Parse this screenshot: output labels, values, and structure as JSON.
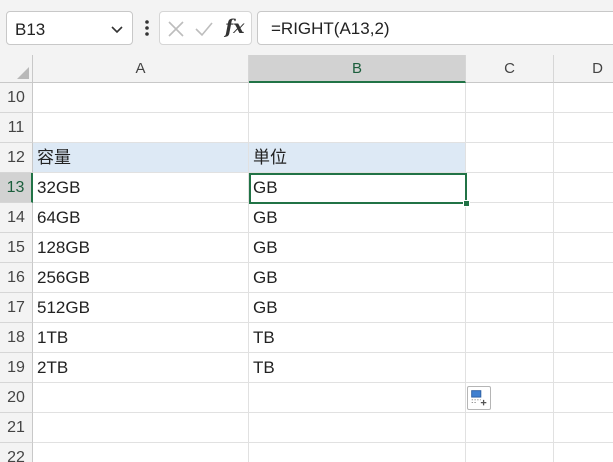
{
  "formula_bar": {
    "name_box": "B13",
    "formula": "=RIGHT(A13,2)",
    "fx_label": "fx"
  },
  "columns": [
    "A",
    "B",
    "C",
    "D"
  ],
  "selected_column": "B",
  "rows": [
    {
      "num": "10",
      "a": "",
      "b": ""
    },
    {
      "num": "11",
      "a": "",
      "b": ""
    },
    {
      "num": "12",
      "a": "容量",
      "b": "単位"
    },
    {
      "num": "13",
      "a": "32GB",
      "b": "GB"
    },
    {
      "num": "14",
      "a": "64GB",
      "b": "GB"
    },
    {
      "num": "15",
      "a": "128GB",
      "b": "GB"
    },
    {
      "num": "16",
      "a": "256GB",
      "b": "GB"
    },
    {
      "num": "17",
      "a": "512GB",
      "b": "GB"
    },
    {
      "num": "18",
      "a": "1TB",
      "b": "TB"
    },
    {
      "num": "19",
      "a": "2TB",
      "b": "TB"
    },
    {
      "num": "20",
      "a": "",
      "b": ""
    },
    {
      "num": "21",
      "a": "",
      "b": ""
    },
    {
      "num": "22",
      "a": "",
      "b": ""
    }
  ],
  "selected_row": "13",
  "colors": {
    "accent": "#217346",
    "header_fill": "#dde9f5",
    "selected_header": "#d2d2d2"
  },
  "icons": {
    "name_box_dropdown": "chevron-down-icon",
    "more": "vertical-dots-icon",
    "cancel": "cancel-x-icon",
    "enter": "check-icon",
    "quick_analysis": "quick-analysis-icon"
  }
}
